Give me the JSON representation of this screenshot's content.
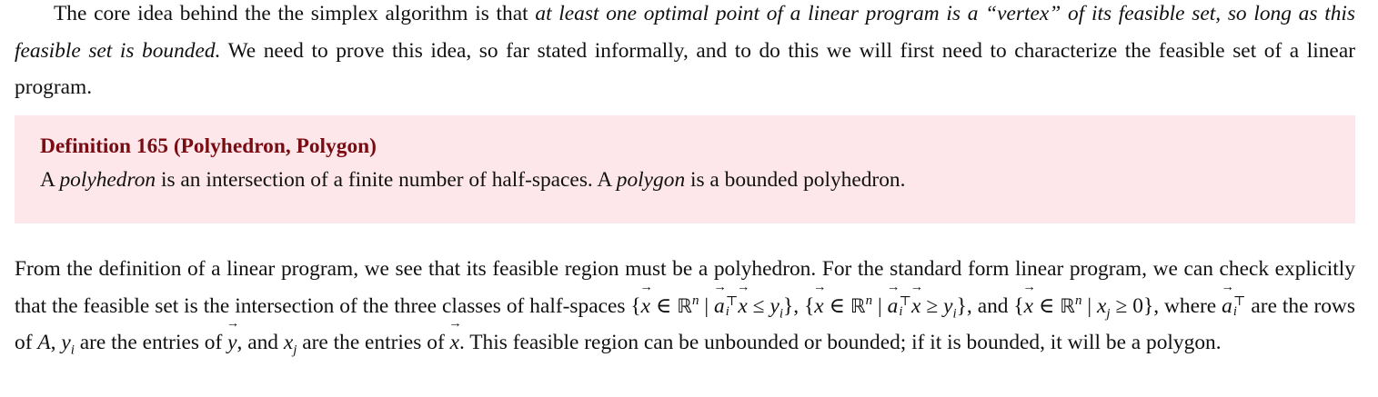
{
  "intro": {
    "lead": "The core idea behind the the simplex algorithm is that ",
    "emph": "at least one optimal point of a linear program is a “vertex” of its feasible set, so long as this feasible set is bounded.",
    "tail": " We need to prove this idea, so far stated informally, and to do this we will first need to characterize the feasible set of a linear program."
  },
  "definition": {
    "title": "Definition 165 (Polyhedron, Polygon)",
    "body_1": "A ",
    "term_1": "polyhedron",
    "body_2": " is an intersection of a finite number of half-spaces. A ",
    "term_2": "polygon",
    "body_3": " is a bounded polyhedron."
  },
  "followup": {
    "t1": "From the definition of a linear program, we see that its feasible region must be a polyhedron. For the standard form linear program, we can check explicitly that the feasible set is the intersection of the three classes of half-spaces ",
    "t2": ", ",
    "t3": ", and ",
    "t4": ", where ",
    "t5": " are the rows of ",
    "t6": ", ",
    "t7": " are the entries of ",
    "t8": ", and ",
    "t9": " are the entries of ",
    "t10": ". This feasible region can be unbounded or bounded; if it is bounded, it will be a polygon."
  },
  "math": {
    "lbrace": "{",
    "rbrace": "}",
    "x": "x",
    "in": " ∈ ",
    "R": "ℝ",
    "n": "n",
    "mid": " | ",
    "a": "a",
    "T": "⊤",
    "i": "i",
    "le": " ≤ ",
    "ge": " ≥ ",
    "y": "y",
    "j": "j",
    "zero": "0",
    "A": "A"
  }
}
